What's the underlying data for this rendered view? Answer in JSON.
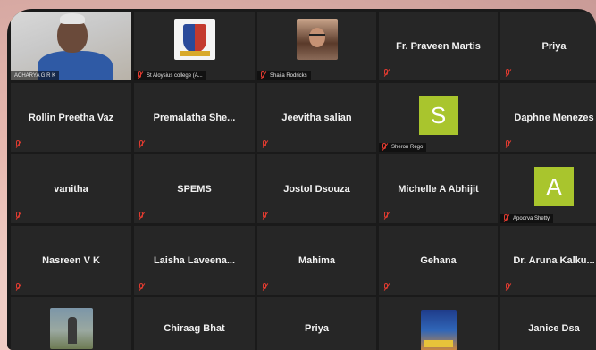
{
  "participants": [
    {
      "name": "ACHARYA G R K",
      "type": "video",
      "active": true
    },
    {
      "name": "St Aloysius college (A...",
      "type": "image",
      "image": "college-crest"
    },
    {
      "name": "Shaila Rodricks",
      "type": "image",
      "image": "profile-photo"
    },
    {
      "name": "Fr. Praveen Martis",
      "type": "name"
    },
    {
      "name": "Priya",
      "type": "name"
    },
    {
      "name": "Rollin Preetha Vaz",
      "type": "name"
    },
    {
      "name": "Premalatha  She...",
      "type": "name"
    },
    {
      "name": "Jeevitha salian",
      "type": "name"
    },
    {
      "name": "Sheron Rego",
      "type": "avatar",
      "initial": "S",
      "color": "#a9c52d"
    },
    {
      "name": "Daphne Menezes",
      "type": "name"
    },
    {
      "name": "vanitha",
      "type": "name"
    },
    {
      "name": "SPEMS",
      "type": "name"
    },
    {
      "name": "Jostol Dsouza",
      "type": "name"
    },
    {
      "name": "Michelle A Abhijit",
      "type": "name"
    },
    {
      "name": "Apoorva Shetty",
      "type": "avatar",
      "initial": "A",
      "color": "#a9c52d"
    },
    {
      "name": "Nasreen V K",
      "type": "name"
    },
    {
      "name": "Laisha  Laveena...",
      "type": "name"
    },
    {
      "name": "Mahima",
      "type": "name"
    },
    {
      "name": "Gehana",
      "type": "name"
    },
    {
      "name": "Dr. Aruna  Kalku...",
      "type": "name"
    },
    {
      "name": "",
      "type": "image",
      "image": "outdoor-photo"
    },
    {
      "name": "Chiraag Bhat",
      "type": "name"
    },
    {
      "name": "Priya",
      "type": "name"
    },
    {
      "name": "",
      "type": "image",
      "image": "poster"
    },
    {
      "name": "Janice Dsa",
      "type": "name"
    }
  ],
  "colors": {
    "muted_mic": "#e03b30",
    "active_speaker_border": "#c8d82a",
    "tile_bg": "#262626"
  }
}
